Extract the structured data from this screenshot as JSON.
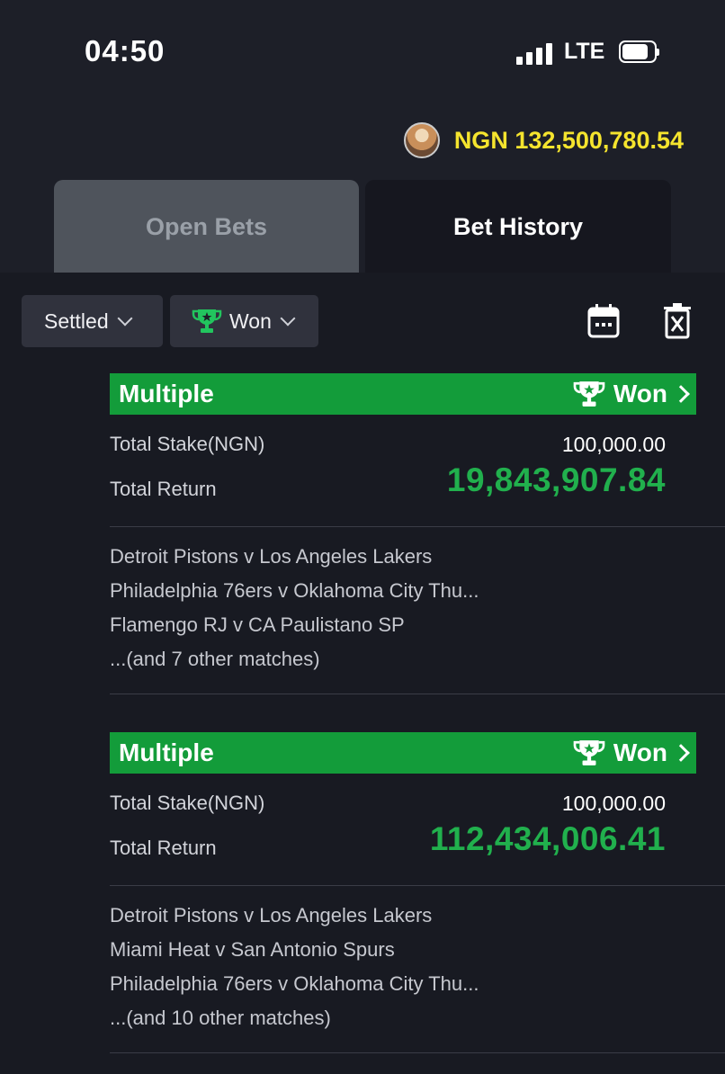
{
  "status_bar": {
    "time": "04:50",
    "network": "LTE"
  },
  "account": {
    "balance": "NGN 132,500,780.54"
  },
  "tabs": [
    {
      "label": "Open Bets",
      "active": false
    },
    {
      "label": "Bet History",
      "active": true
    }
  ],
  "filters": {
    "status": "Settled",
    "result": "Won"
  },
  "colors": {
    "won_green": "#139c3a",
    "return_green": "#21b04d",
    "balance_yellow": "#f5e42e"
  },
  "bets": [
    {
      "type": "Multiple",
      "status": "Won",
      "stake_label": "Total Stake(NGN)",
      "stake": "100,000.00",
      "return_label": "Total Return",
      "return": "19,843,907.84",
      "matches": [
        "Detroit Pistons v Los Angeles Lakers",
        "Philadelphia 76ers v Oklahoma City Thu...",
        "Flamengo RJ v CA Paulistano SP",
        "...(and 7 other matches)"
      ]
    },
    {
      "type": "Multiple",
      "status": "Won",
      "stake_label": "Total Stake(NGN)",
      "stake": "100,000.00",
      "return_label": "Total Return",
      "return": "112,434,006.41",
      "matches": [
        "Detroit Pistons v Los Angeles Lakers",
        "Miami Heat v San Antonio Spurs",
        "Philadelphia 76ers v Oklahoma City Thu...",
        "...(and 10 other matches)"
      ]
    }
  ]
}
